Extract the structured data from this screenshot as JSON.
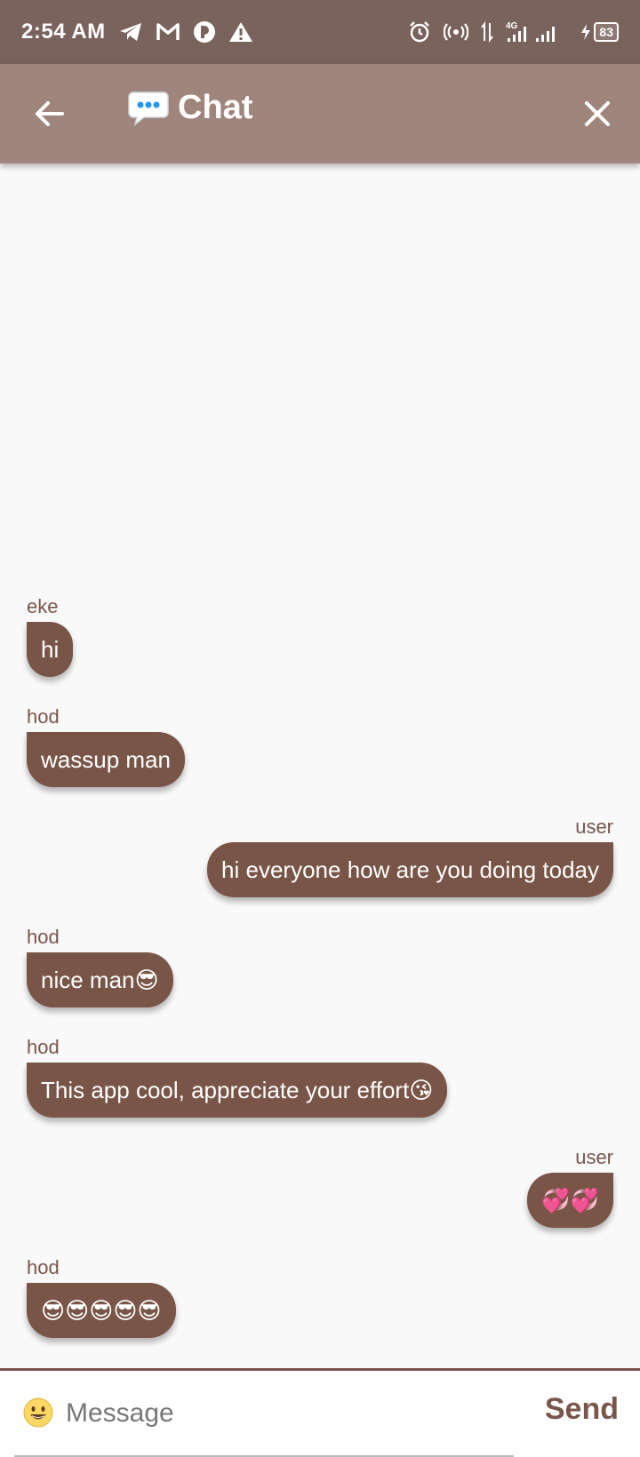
{
  "status_bar": {
    "time": "2:54 AM",
    "battery": "83",
    "network": "4G"
  },
  "app_bar": {
    "title": "Chat"
  },
  "messages": [
    {
      "sender": "eke",
      "text": "hi",
      "side": "left"
    },
    {
      "sender": "hod",
      "text": "wassup man",
      "side": "left"
    },
    {
      "sender": "user",
      "text": "hi everyone how are you doing today",
      "side": "right"
    },
    {
      "sender": "hod",
      "text": "nice man😎",
      "side": "left"
    },
    {
      "sender": "hod",
      "text": "This app cool, appreciate your effort😘",
      "side": "left"
    },
    {
      "sender": "user",
      "text": "💞💞",
      "side": "right"
    },
    {
      "sender": "hod",
      "text": "😎😎😎😎😎",
      "side": "left"
    }
  ],
  "composer": {
    "placeholder": "Message",
    "send_label": "Send"
  },
  "colors": {
    "status_bar": "#79635c",
    "app_bar": "#a0857c",
    "bubble": "#795548",
    "accent": "#79554a"
  }
}
